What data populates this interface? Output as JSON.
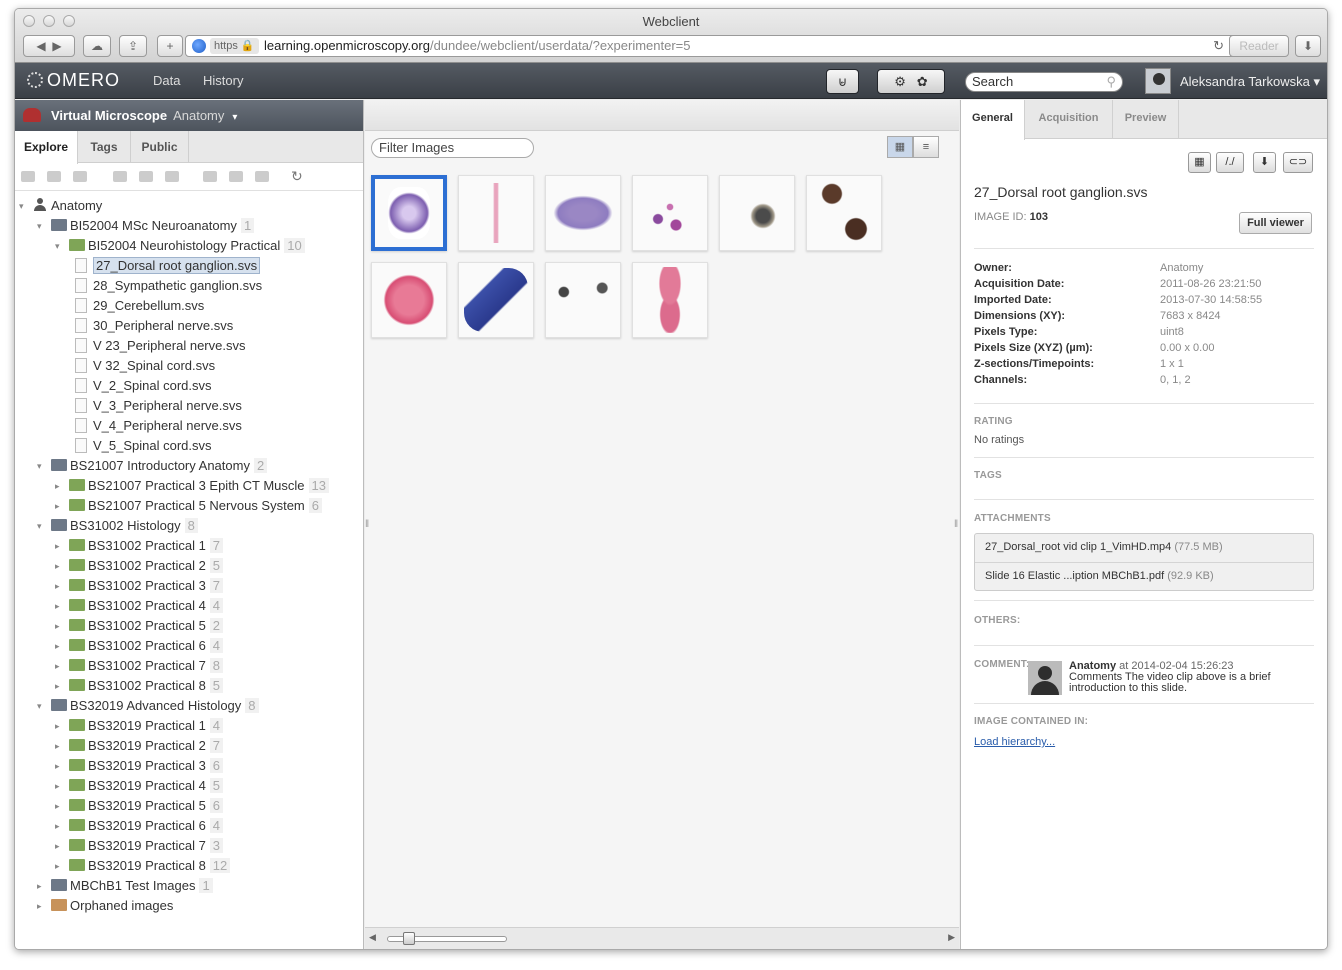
{
  "browser": {
    "title": "Webclient",
    "url_scheme": "https",
    "url_host": "learning.openmicroscopy.org",
    "url_path": "/dundee/webclient/userdata/?experimenter=5",
    "reader_label": "Reader"
  },
  "header": {
    "logo": "OMERO",
    "nav": [
      "Data",
      "History"
    ],
    "search_placeholder": "Search",
    "user_name": "Aleksandra Tarkowska",
    "user_caret": "▾"
  },
  "left": {
    "group_name": "Virtual Microscope",
    "group_user": "Anatomy",
    "caret": "▾",
    "tabs": [
      "Explore",
      "Tags",
      "Public"
    ],
    "tree": [
      {
        "label": "Anatomy",
        "type": "user",
        "level": 0,
        "open": true
      },
      {
        "label": "BI52004 MSc Neuroanatomy",
        "count": "1",
        "type": "proj",
        "level": 1,
        "open": true
      },
      {
        "label": "BI52004 Neurohistology Practical",
        "count": "10",
        "type": "ds",
        "level": 2,
        "open": true
      },
      {
        "label": "27_Dorsal root ganglion.svs",
        "type": "img",
        "level": 3,
        "selected": true
      },
      {
        "label": "28_Sympathetic ganglion.svs",
        "type": "img",
        "level": 3
      },
      {
        "label": "29_Cerebellum.svs",
        "type": "img",
        "level": 3
      },
      {
        "label": "30_Peripheral nerve.svs",
        "type": "img",
        "level": 3
      },
      {
        "label": "V 23_Peripheral nerve.svs",
        "type": "img",
        "level": 3
      },
      {
        "label": "V 32_Spinal cord.svs",
        "type": "img",
        "level": 3
      },
      {
        "label": "V_2_Spinal cord.svs",
        "type": "img",
        "level": 3
      },
      {
        "label": "V_3_Peripheral nerve.svs",
        "type": "img",
        "level": 3
      },
      {
        "label": "V_4_Peripheral nerve.svs",
        "type": "img",
        "level": 3
      },
      {
        "label": "V_5_Spinal cord.svs",
        "type": "img",
        "level": 3
      },
      {
        "label": "BS21007 Introductory Anatomy",
        "count": "2",
        "type": "proj",
        "level": 1,
        "open": true
      },
      {
        "label": "BS21007 Practical 3 Epith CT Muscle",
        "count": "13",
        "type": "ds",
        "level": 2
      },
      {
        "label": "BS21007 Practical 5 Nervous System",
        "count": "6",
        "type": "ds",
        "level": 2
      },
      {
        "label": "BS31002 Histology",
        "count": "8",
        "type": "proj",
        "level": 1,
        "open": true
      },
      {
        "label": "BS31002 Practical 1",
        "count": "7",
        "type": "ds",
        "level": 2
      },
      {
        "label": "BS31002 Practical 2",
        "count": "5",
        "type": "ds",
        "level": 2
      },
      {
        "label": "BS31002 Practical 3",
        "count": "7",
        "type": "ds",
        "level": 2
      },
      {
        "label": "BS31002 Practical 4",
        "count": "4",
        "type": "ds",
        "level": 2
      },
      {
        "label": "BS31002 Practical 5",
        "count": "2",
        "type": "ds",
        "level": 2
      },
      {
        "label": "BS31002 Practical 6",
        "count": "4",
        "type": "ds",
        "level": 2
      },
      {
        "label": "BS31002 Practical 7",
        "count": "8",
        "type": "ds",
        "level": 2
      },
      {
        "label": "BS31002 Practical 8",
        "count": "5",
        "type": "ds",
        "level": 2
      },
      {
        "label": "BS32019 Advanced Histology",
        "count": "8",
        "type": "proj",
        "level": 1,
        "open": true
      },
      {
        "label": "BS32019 Practical 1",
        "count": "4",
        "type": "ds",
        "level": 2
      },
      {
        "label": "BS32019 Practical 2",
        "count": "7",
        "type": "ds",
        "level": 2
      },
      {
        "label": "BS32019 Practical 3",
        "count": "6",
        "type": "ds",
        "level": 2
      },
      {
        "label": "BS32019 Practical 4",
        "count": "5",
        "type": "ds",
        "level": 2
      },
      {
        "label": "BS32019 Practical 5",
        "count": "6",
        "type": "ds",
        "level": 2
      },
      {
        "label": "BS32019 Practical 6",
        "count": "4",
        "type": "ds",
        "level": 2
      },
      {
        "label": "BS32019 Practical 7",
        "count": "3",
        "type": "ds",
        "level": 2
      },
      {
        "label": "BS32019 Practical 8",
        "count": "12",
        "type": "ds",
        "level": 2
      },
      {
        "label": "MBChB1 Test Images",
        "count": "1",
        "type": "proj",
        "level": 1
      },
      {
        "label": "Orphaned images",
        "type": "orph",
        "level": 1
      }
    ]
  },
  "center": {
    "filter_placeholder": "Filter Images",
    "thumbnails": [
      "27_Dorsal root ganglion.svs",
      "28_Sympathetic ganglion.svs",
      "29_Cerebellum.svs",
      "30_Peripheral nerve.svs",
      "V 23_Peripheral nerve.svs",
      "V 32_Spinal cord.svs",
      "V_2_Spinal cord.svs",
      "V_3_Peripheral nerve.svs",
      "V_4_Peripheral nerve.svs",
      "V_5_Spinal cord.svs"
    ]
  },
  "right": {
    "tabs": [
      "General",
      "Acquisition",
      "Preview"
    ],
    "image_name": "27_Dorsal root ganglion.svs",
    "image_id_label": "IMAGE ID:",
    "image_id": "103",
    "full_viewer": "Full viewer",
    "details": [
      {
        "k": "Owner:",
        "v": "Anatomy"
      },
      {
        "k": "Acquisition Date:",
        "v": "2011-08-26 23:21:50"
      },
      {
        "k": "Imported Date:",
        "v": "2013-07-30 14:58:55"
      },
      {
        "k": "Dimensions (XY):",
        "v": "7683 x 8424"
      },
      {
        "k": "Pixels Type:",
        "v": "uint8"
      },
      {
        "k": "Pixels Size (XYZ) (µm):",
        "v": "0.00 x 0.00"
      },
      {
        "k": "Z-sections/Timepoints:",
        "v": "1 x 1"
      },
      {
        "k": "Channels:",
        "v": "0, 1, 2"
      }
    ],
    "rating_label": "RATING",
    "rating_value": "No ratings",
    "tags_label": "TAGS",
    "attachments_label": "ATTACHMENTS",
    "attachments": [
      {
        "name": "27_Dorsal_root vid clip 1_VimHD.mp4",
        "size": "(77.5 MB)"
      },
      {
        "name": "Slide 16 Elastic ...iption MBChB1.pdf",
        "size": "(92.9 KB)"
      }
    ],
    "others_label": "OTHERS:",
    "comment_label": "COMMENT:",
    "comment_author": "Anatomy",
    "comment_at": "at 2014-02-04 15:26:23",
    "comment_text": "Comments The video clip above is a brief introduction to this slide.",
    "contained_label": "IMAGE CONTAINED IN:",
    "load_hierarchy": "Load hierarchy..."
  },
  "colors": {
    "selected_border": "#2d6fd3",
    "header_bg": "#454b53",
    "link": "#2a5dab"
  }
}
